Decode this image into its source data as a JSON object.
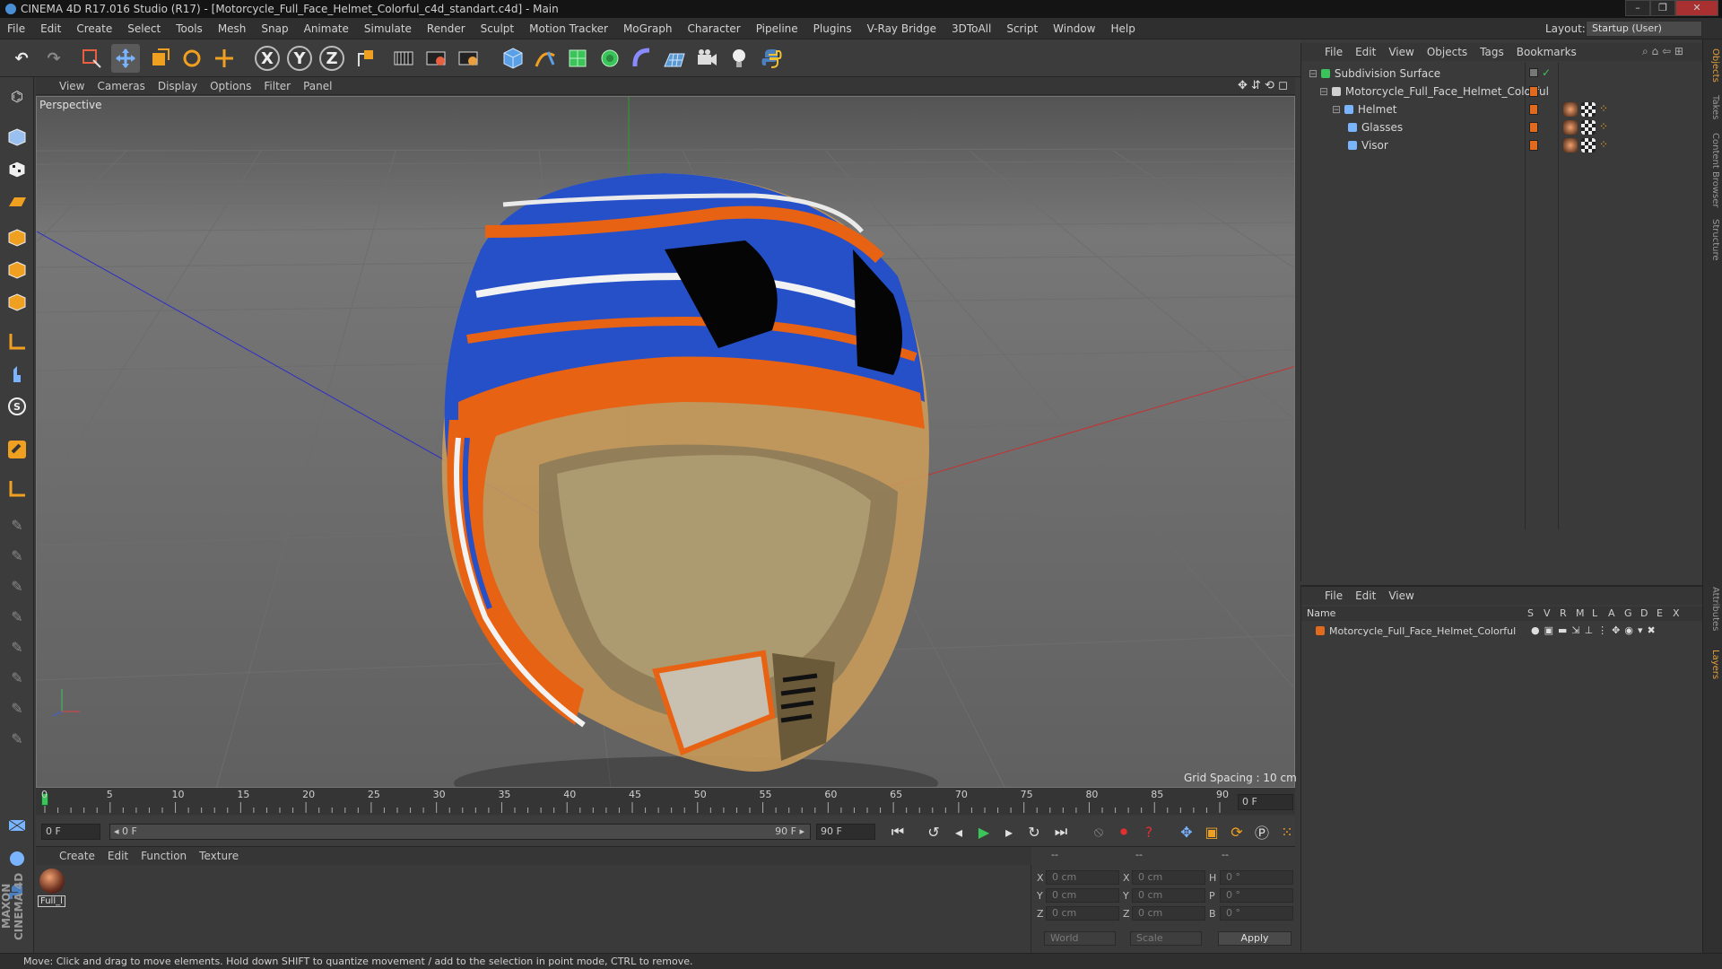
{
  "window": {
    "title": "CINEMA 4D R17.016 Studio (R17) - [Motorcycle_Full_Face_Helmet_Colorful_c4d_standart.c4d] - Main",
    "controls": [
      "–",
      "❐",
      "✕"
    ]
  },
  "menubar": {
    "items": [
      "File",
      "Edit",
      "Create",
      "Select",
      "Tools",
      "Mesh",
      "Snap",
      "Animate",
      "Simulate",
      "Render",
      "Sculpt",
      "Motion Tracker",
      "MoGraph",
      "Character",
      "Pipeline",
      "Plugins",
      "V-Ray Bridge",
      "3DToAll",
      "Script",
      "Window",
      "Help"
    ],
    "layout_label": "Layout:",
    "layout_value": "Startup (User)"
  },
  "toolbar": {
    "axis_x": "X",
    "axis_y": "Y",
    "axis_z": "Z"
  },
  "viewport": {
    "menu": [
      "View",
      "Cameras",
      "Display",
      "Options",
      "Filter",
      "Panel"
    ],
    "label": "Perspective",
    "grid_spacing": "Grid Spacing : 10 cm"
  },
  "timeline": {
    "ticks": [
      "0",
      "5",
      "10",
      "15",
      "20",
      "25",
      "30",
      "35",
      "40",
      "45",
      "50",
      "55",
      "60",
      "65",
      "70",
      "75",
      "80",
      "85",
      "90"
    ],
    "current_frame": "0 F",
    "start_field": "0 F",
    "range_start": "◂ 0 F",
    "range_end": "90 F ▸",
    "end_field": "90 F"
  },
  "materials": {
    "menu": [
      "Create",
      "Edit",
      "Function",
      "Texture"
    ],
    "items": [
      {
        "label": "Full_l"
      }
    ]
  },
  "coordinates": {
    "headers": [
      "--",
      "--",
      "--"
    ],
    "rows": [
      {
        "a": "X",
        "av": "0 cm",
        "b": "X",
        "bv": "0 cm",
        "c": "H",
        "cv": "0 °"
      },
      {
        "a": "Y",
        "av": "0 cm",
        "b": "Y",
        "bv": "0 cm",
        "c": "P",
        "cv": "0 °"
      },
      {
        "a": "Z",
        "av": "0 cm",
        "b": "Z",
        "bv": "0 cm",
        "c": "B",
        "cv": "0 °"
      }
    ],
    "space": "World",
    "mode": "Scale",
    "apply": "Apply"
  },
  "status": {
    "text": "Move: Click and drag to move elements. Hold down SHIFT to quantize movement / add to the selection in point mode, CTRL to remove."
  },
  "objects_panel": {
    "menu": [
      "File",
      "Edit",
      "View",
      "Objects",
      "Tags",
      "Bookmarks"
    ],
    "items": [
      {
        "name": "Subdivision Surface"
      },
      {
        "name": "Motorcycle_Full_Face_Helmet_Colorful"
      },
      {
        "name": "Helmet"
      },
      {
        "name": "Glasses"
      },
      {
        "name": "Visor"
      }
    ]
  },
  "layers_panel": {
    "menu": [
      "File",
      "Edit",
      "View"
    ],
    "name_header": "Name",
    "col_headers": [
      "S",
      "V",
      "R",
      "M",
      "L",
      "A",
      "G",
      "D",
      "E",
      "X"
    ],
    "items": [
      {
        "name": "Motorcycle_Full_Face_Helmet_Colorful"
      }
    ]
  },
  "right_tabs": [
    "Objects",
    "Takes",
    "Content Browser",
    "Structure",
    "Attributes",
    "Layers"
  ],
  "brand": "MAXON CINEMA 4D",
  "colors": {
    "accent_orange": "#e06a1e",
    "viewport_bg": "#5e5e5e",
    "helmet_blue": "#2650c8",
    "helmet_orange": "#e86214"
  }
}
